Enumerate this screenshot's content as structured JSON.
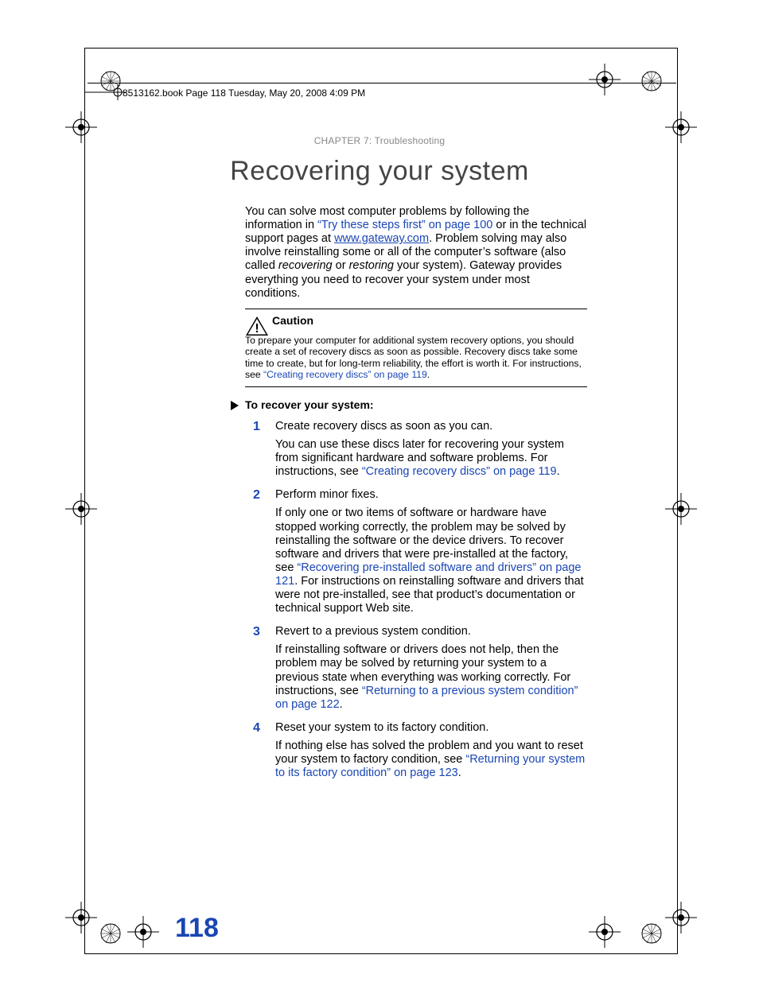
{
  "meta": {
    "crop_header": "8513162.book  Page 118  Tuesday, May 20, 2008  4:09 PM",
    "chapter_header": "CHAPTER 7: Troubleshooting",
    "page_number": "118"
  },
  "section_title": "Recovering your system",
  "intro": {
    "pre_link": "You can solve most computer problems by following the information in ",
    "xref1": "“Try these steps first” on page 100",
    "mid1": " or in the technical support pages at ",
    "url": "www.gateway.com",
    "mid2": ". Problem solving may also involve reinstalling some or all of the computer’s software (also called ",
    "ital1": "recovering",
    "mid3": " or ",
    "ital2": "restoring",
    "tail": " your system). Gateway provides everything you need to recover your system under most conditions."
  },
  "caution": {
    "label": "Caution",
    "text_pre": "To prepare your computer for additional system recovery options, you should create a set of recovery discs as soon as possible. Recovery discs take some time to create, but for long-term reliability, the effort is worth it. For instructions, see ",
    "xref": "“Creating recovery discs” on page 119",
    "text_post": "."
  },
  "procedure_heading": "To recover your system:",
  "steps": [
    {
      "num": "1",
      "title": "Create recovery discs as soon as you can.",
      "body_pre": "You can use these discs later for recovering your system from significant hardware and software problems. For instructions, see ",
      "xref": "“Creating recovery discs” on page 119",
      "body_post": "."
    },
    {
      "num": "2",
      "title": "Perform minor fixes.",
      "body_pre": "If only one or two items of software or hardware have stopped working correctly, the problem may be solved by reinstalling the software or the device drivers. To recover software and drivers that were pre-installed at the factory, see ",
      "xref": "“Recovering pre-installed software and drivers” on page 121",
      "body_post": ". For instructions on reinstalling software and drivers that were not pre-installed, see that product’s documentation or technical support Web site."
    },
    {
      "num": "3",
      "title": "Revert to a previous system condition.",
      "body_pre": "If reinstalling software or drivers does not help, then the problem may be solved by returning your system to a previous state when everything was working correctly. For instructions, see ",
      "xref": "“Returning to a previous system condition” on page 122",
      "body_post": "."
    },
    {
      "num": "4",
      "title": "Reset your system to its factory condition.",
      "body_pre": "If nothing else has solved the problem and you want to reset your system to factory condition, see ",
      "xref": "“Returning your system to its factory condition” on page 123",
      "body_post": "."
    }
  ]
}
